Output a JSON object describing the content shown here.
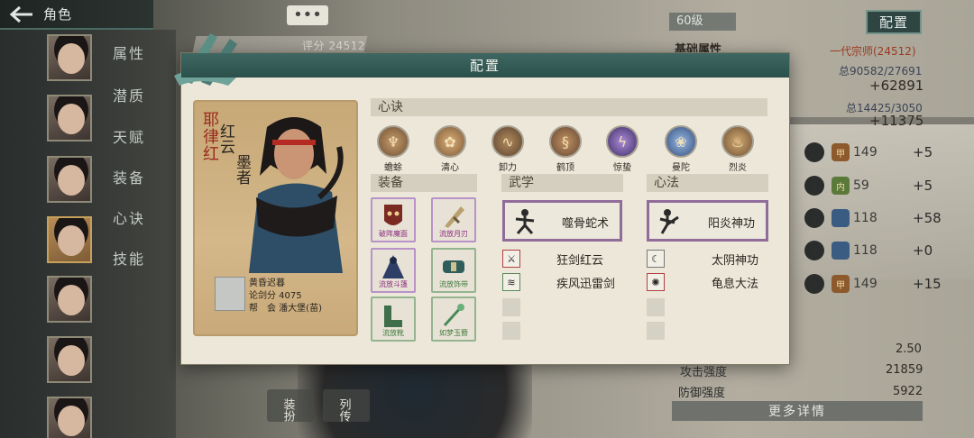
{
  "topbar": {
    "back_icon": "back-arrow-icon",
    "title": "角色"
  },
  "sidebar": {
    "items": [
      "属性",
      "潜质",
      "天赋",
      "装备",
      "心诀",
      "技能"
    ]
  },
  "chat": {
    "label": "•••"
  },
  "score": "评分 24512",
  "level": "60级",
  "config_button": "配置",
  "right_panel": {
    "basic_title": "基础属性",
    "rank": "一代宗师(24512)",
    "total1": "总90582/27691",
    "value1": "+62891",
    "total2": "总14425/3050",
    "value2": "+11375",
    "stats": [
      {
        "badge": "甲",
        "value": "149",
        "bonus": "+5"
      },
      {
        "badge": "内",
        "value": "59",
        "bonus": "+5"
      },
      {
        "badge": "",
        "value": "118",
        "bonus": "+58"
      },
      {
        "badge": "",
        "value": "118",
        "bonus": "+0"
      },
      {
        "badge": "甲",
        "value": "149",
        "bonus": "+15"
      }
    ],
    "crit": "2.50",
    "attack_label": "攻击强度",
    "attack_value": "21859",
    "defense_label": "防御强度",
    "defense_value": "5922",
    "more": "更多详情"
  },
  "bottom_tabs": [
    "装扮",
    "列传"
  ],
  "modal": {
    "title": "配置",
    "character": {
      "name": "耶律红",
      "title_line1": "红云",
      "title_line2": "墨者",
      "player": "黄昏迟暮",
      "sword": "论剑分 4075",
      "guild": "帮　会 潘大堡(苗)"
    },
    "sections": {
      "xinjue": "心诀",
      "equip": "装备",
      "wuxue": "武学",
      "xinfa": "心法"
    },
    "xinjue_skills": [
      {
        "label": "蟾蜍",
        "color": "#8a6a48"
      },
      {
        "label": "清心",
        "color": "#a07a52"
      },
      {
        "label": "卸力",
        "color": "#6f5a40"
      },
      {
        "label": "鹤顶",
        "color": "#7b5f44"
      },
      {
        "label": "惊蛰",
        "color": "#5b4a82"
      },
      {
        "label": "曼陀",
        "color": "#4a6690"
      },
      {
        "label": "烈炎",
        "color": "#7a6040"
      }
    ],
    "equipment": [
      {
        "label": "破阵魔面",
        "grade": "purple"
      },
      {
        "label": "流放月刃",
        "grade": "purple"
      },
      {
        "label": "流放斗篷",
        "grade": "purple"
      },
      {
        "label": "流放饰带",
        "grade": "green"
      },
      {
        "label": "流放靴",
        "grade": "green"
      },
      {
        "label": "如梦玉簪",
        "grade": "green"
      }
    ],
    "wuxue": {
      "main": "噬骨蛇术",
      "sub": [
        "狂剑红云",
        "疾风迅雷剑"
      ]
    },
    "xinfa": {
      "main": "阳炎神功",
      "sub": [
        "太阴神功",
        "龟息大法"
      ]
    }
  }
}
